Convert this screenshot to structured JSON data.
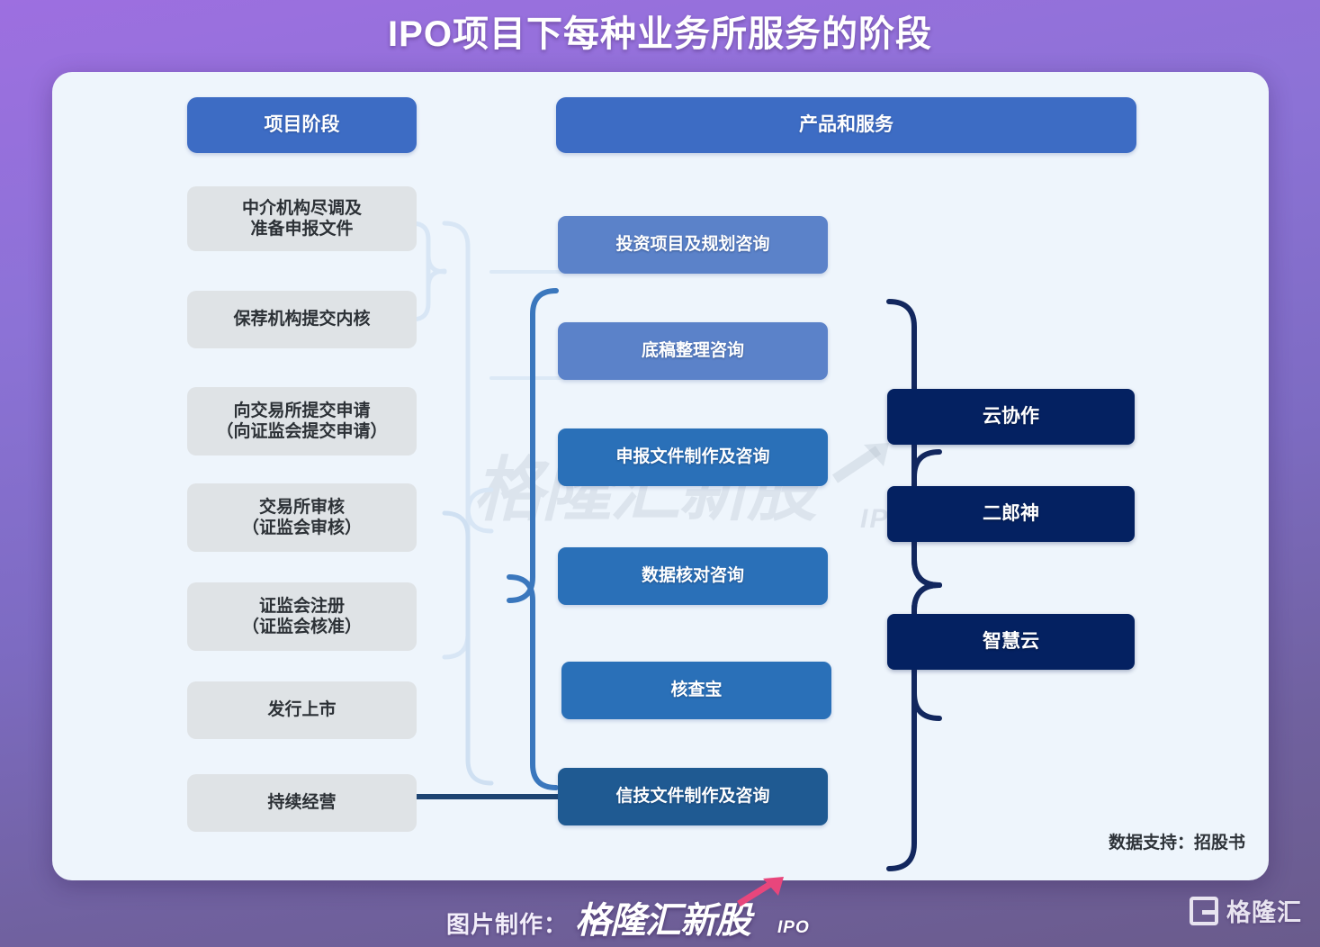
{
  "title": "IPO项目下每种业务所服务的阶段",
  "headers": {
    "left": "项目阶段",
    "right": "产品和服务"
  },
  "stages": [
    {
      "label": "中介机构尽调及\n准备申报文件"
    },
    {
      "label": "保荐机构提交内核"
    },
    {
      "label": "向交易所提交申请\n（向证监会提交申请）"
    },
    {
      "label": "交易所审核\n（证监会审核）"
    },
    {
      "label": "证监会注册\n（证监会核准）"
    },
    {
      "label": "发行上市"
    },
    {
      "label": "持续经营"
    }
  ],
  "services": [
    {
      "label": "投资项目及规划咨询",
      "tone": "svc-l1"
    },
    {
      "label": "底稿整理咨询",
      "tone": "svc-l1"
    },
    {
      "label": "申报文件制作及咨询",
      "tone": "svc-l2"
    },
    {
      "label": "数据核对咨询",
      "tone": "svc-l2"
    },
    {
      "label": "核查宝",
      "tone": "svc-l2"
    },
    {
      "label": "信技文件制作及咨询",
      "tone": "svc-l3"
    }
  ],
  "products": [
    {
      "label": "云协作"
    },
    {
      "label": "二郎神"
    },
    {
      "label": "智慧云"
    }
  ],
  "source_note": "数据支持：招股书",
  "footer": {
    "credit_label": "图片制作：",
    "credit_brand": "格隆汇新股",
    "credit_ipo": "IPO",
    "brand_name": "格隆汇",
    "brand_icon": "g-logo-icon"
  },
  "watermark": {
    "text": "格隆汇新股",
    "ipo": "IPO"
  },
  "colors": {
    "header_blue": "#3d6cc4",
    "stage_gray": "#dfe3e6",
    "service_light": "#5b82c9",
    "service_mid": "#2a70b8",
    "service_dark": "#1f5a92",
    "product_navy": "#042161",
    "card_bg": "#eef5fc",
    "bracket_light": "#cfe0f2",
    "bracket_mid": "#3a77bd",
    "bracket_dark": "#12275e",
    "accent_pink": "#e8467c"
  }
}
